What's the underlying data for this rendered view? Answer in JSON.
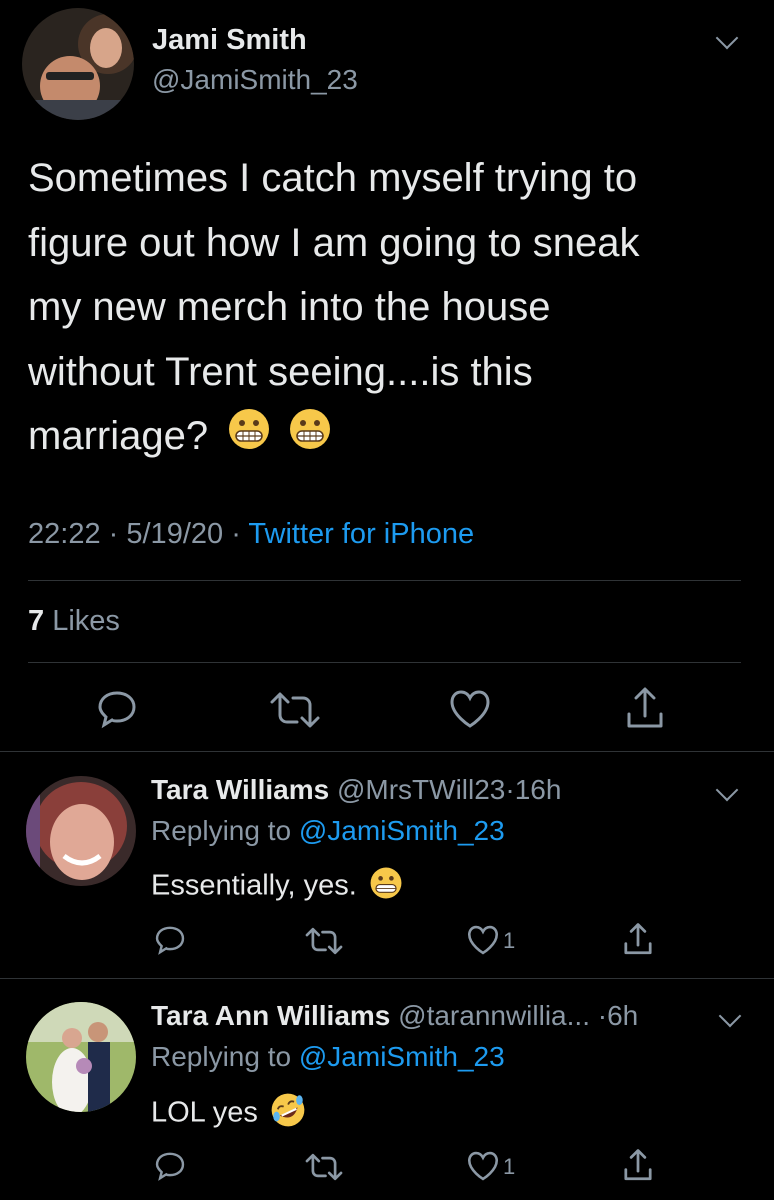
{
  "tweet": {
    "author_name": "Jami Smith",
    "author_handle": "@JamiSmith_23",
    "text_lines": [
      "Sometimes I catch myself trying to",
      "figure out how I am going to sneak",
      "my new merch into the house",
      "without Trent seeing....is this",
      "marriage?"
    ],
    "time": "22:22",
    "date": "5/19/20",
    "source": "Twitter for iPhone",
    "likes_count": "7",
    "likes_label": "Likes",
    "sep": "·"
  },
  "replies": [
    {
      "name": "Tara Williams",
      "handle": "@MrsTWill23",
      "age": "16h",
      "replying_label": "Replying to",
      "replying_handle": "@JamiSmith_23",
      "text": "Essentially, yes.",
      "like_count": "1"
    },
    {
      "name": "Tara Ann Williams",
      "handle": "@tarannwillia...",
      "age": "6h",
      "replying_label": "Replying to",
      "replying_handle": "@JamiSmith_23",
      "text": "LOL yes",
      "like_count": "1"
    }
  ],
  "colors": {
    "background": "#000000",
    "accent": "#1d9bf0",
    "muted": "#8b98a5",
    "divider": "#2f3336"
  },
  "icons": [
    "reply-icon",
    "retweet-icon",
    "like-icon",
    "share-icon",
    "chevron-down-icon",
    "grimacing-emoji",
    "rofl-emoji"
  ]
}
